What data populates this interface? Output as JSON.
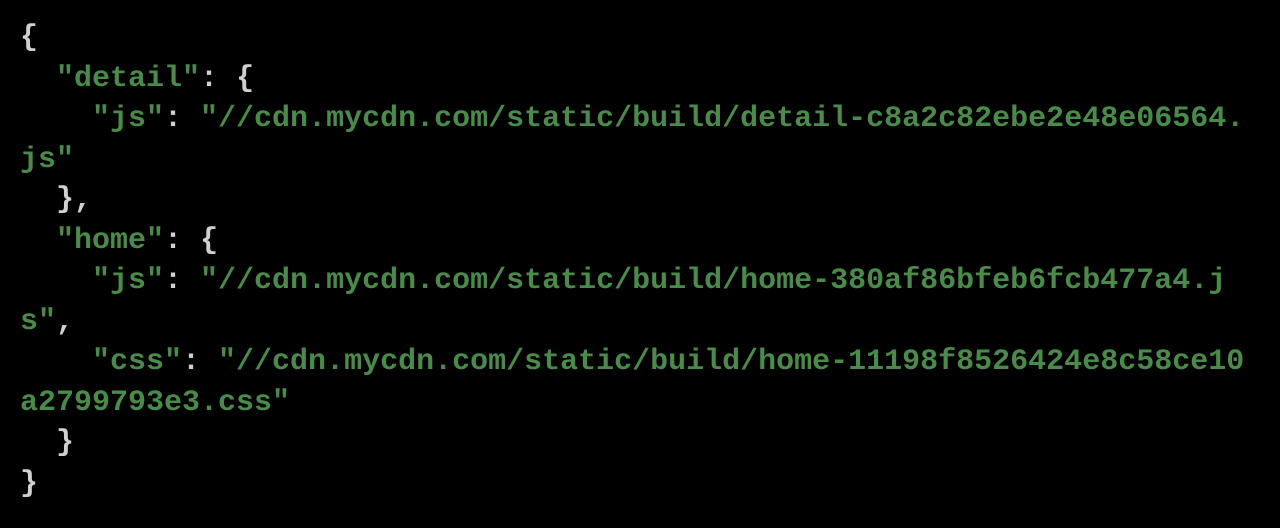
{
  "code": {
    "l1": "{",
    "l2_indent": "  ",
    "l2_key": "\"detail\"",
    "l2_colon": ": ",
    "l2_brace": "{",
    "l3_indent": "    ",
    "l3_key": "\"js\"",
    "l3_colon": ": ",
    "l3_value": "\"//cdn.mycdn.com/static/build/detail-c8a2c82ebe2e48e06564.js\"",
    "l4_indent": "  ",
    "l4_brace": "}",
    "l4_comma": ",",
    "l5_indent": "  ",
    "l5_key": "\"home\"",
    "l5_colon": ": ",
    "l5_brace": "{",
    "l6_indent": "    ",
    "l6_key": "\"js\"",
    "l6_colon": ": ",
    "l6_value": "\"//cdn.mycdn.com/static/build/home-380af86bfeb6fcb477a4.js\"",
    "l6_comma": ",",
    "l7_indent": "    ",
    "l7_key": "\"css\"",
    "l7_colon": ": ",
    "l7_value": "\"//cdn.mycdn.com/static/build/home-11198f8526424e8c58ce10a2799793e3.css\"",
    "l8_indent": "  ",
    "l8_brace": "}",
    "l9": "}"
  }
}
